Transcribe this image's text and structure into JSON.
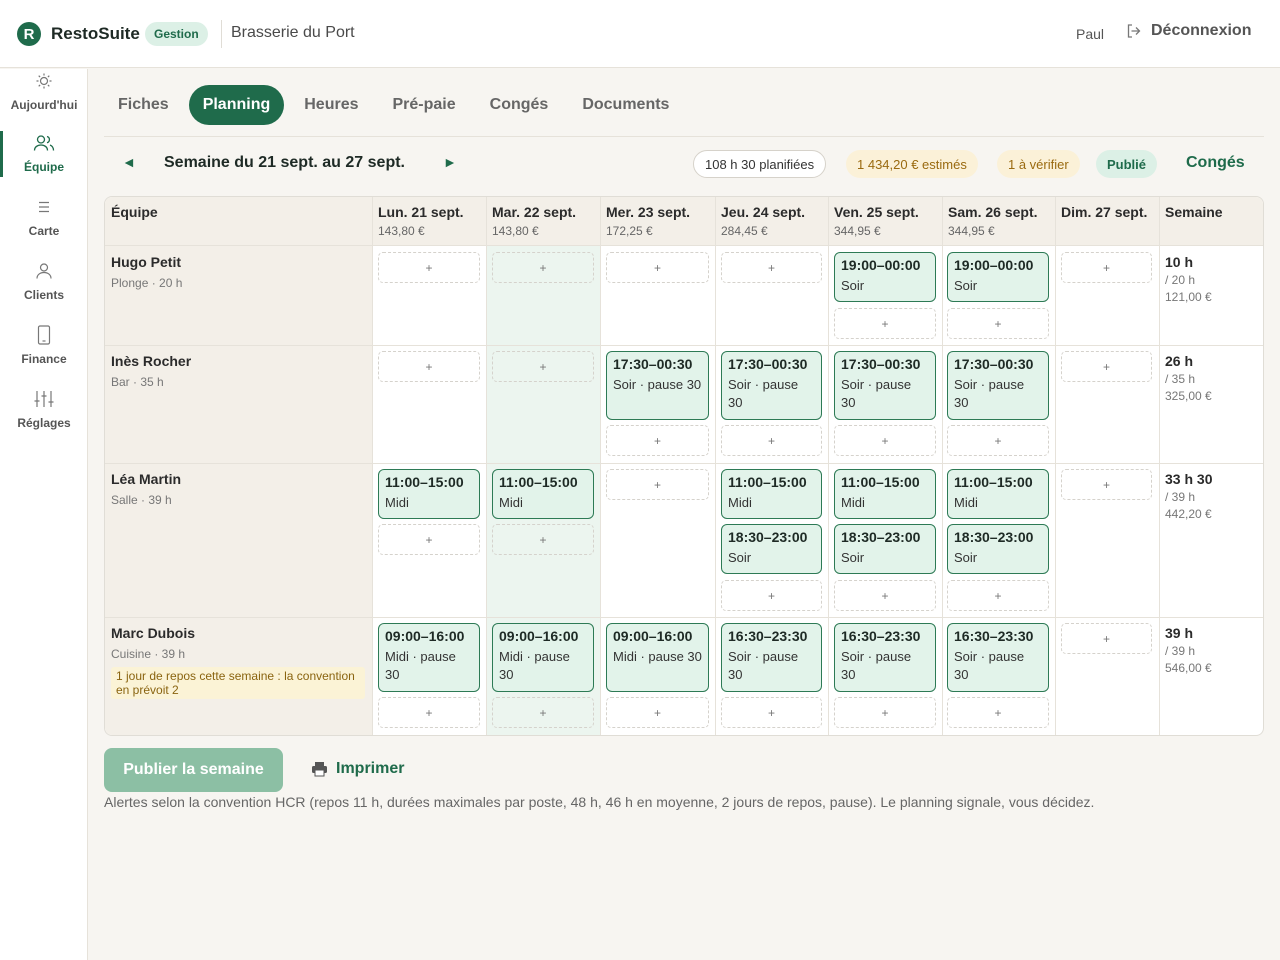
{
  "header": {
    "logo_letter": "R",
    "app_name": "RestoSuite",
    "badge": "Gestion",
    "restaurant": "Brasserie du Port",
    "user": "Paul",
    "logout": "Déconnexion"
  },
  "sidebar": {
    "items": [
      {
        "label": "Aujourd'hui",
        "icon": "sun-icon"
      },
      {
        "label": "Équipe",
        "icon": "team-icon"
      },
      {
        "label": "Carte",
        "icon": "menu-list-icon"
      },
      {
        "label": "Clients",
        "icon": "user-icon"
      },
      {
        "label": "Finance",
        "icon": "phone-icon"
      },
      {
        "label": "Réglages",
        "icon": "sliders-icon"
      }
    ]
  },
  "tabs": [
    "Fiches",
    "Planning",
    "Heures",
    "Pré-paie",
    "Congés",
    "Documents"
  ],
  "week": {
    "prev": "◄",
    "next": "►",
    "title": "Semaine du 21 sept. au 27 sept.",
    "hours_chip": "108 h 30 planifiées",
    "cost_chip": "1 434,20 € estimés",
    "verify_chip": "1 à vérifier",
    "status_chip": "Publié",
    "conges_link": "Congés"
  },
  "grid": {
    "team_header": "Équipe",
    "week_header": "Semaine",
    "days": [
      {
        "label": "Lun. 21 sept.",
        "cost": "143,80 €"
      },
      {
        "label": "Mar. 22 sept.",
        "cost": "143,80 €"
      },
      {
        "label": "Mer. 23 sept.",
        "cost": "172,25 €"
      },
      {
        "label": "Jeu. 24 sept.",
        "cost": "284,45 €"
      },
      {
        "label": "Ven. 25 sept.",
        "cost": "344,95 €"
      },
      {
        "label": "Sam. 26 sept.",
        "cost": "344,95 €"
      },
      {
        "label": "Dim. 27 sept.",
        "cost": ""
      }
    ],
    "employees": [
      {
        "name": "Hugo Petit",
        "sub": "Plonge · 20 h",
        "alert": "",
        "week_hours": "10 h",
        "week_target": "/ 20 h",
        "week_cost": "121,00 €"
      },
      {
        "name": "Inès Rocher",
        "sub": "Bar · 35 h",
        "alert": "",
        "week_hours": "26 h",
        "week_target": "/ 35 h",
        "week_cost": "325,00 €"
      },
      {
        "name": "Léa Martin",
        "sub": "Salle · 39 h",
        "alert": "",
        "week_hours": "33 h 30",
        "week_target": "/ 39 h",
        "week_cost": "442,20 €"
      },
      {
        "name": "Marc Dubois",
        "sub": "Cuisine · 39 h",
        "alert": "1 jour de repos cette semaine : la convention en prévoit 2",
        "week_hours": "39 h",
        "week_target": "/ 39 h",
        "week_cost": "546,00 €"
      }
    ],
    "shifts": {
      "soir_short": {
        "time": "19:00–00:00",
        "label": "Soir"
      },
      "bar": {
        "time": "17:30–00:30",
        "label": "Soir · pause 30"
      },
      "midi": {
        "time": "11:00–15:00",
        "label": "Midi"
      },
      "soir_lea": {
        "time": "18:30–23:00",
        "label": "Soir"
      },
      "cuisine_midi": {
        "time": "09:00–16:00",
        "label": "Midi · pause 30"
      },
      "cuisine_soir": {
        "time": "16:30–23:30",
        "label": "Soir · pause 30"
      }
    },
    "add_symbol": "+"
  },
  "footer": {
    "publish": "Publier la semaine",
    "print": "Imprimer",
    "note": "Alertes selon la convention HCR (repos 11 h, durées maximales par poste, 48 h, 46 h en moyenne, 2 jours de repos, pause). Le planning signale, vous décidez."
  },
  "colors": {
    "brand": "#1f6b4b",
    "shift_bg": "#e2f3ea",
    "warning": "#9a6a10"
  }
}
